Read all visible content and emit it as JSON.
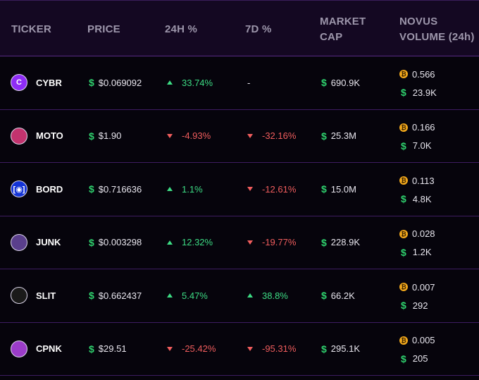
{
  "headers": {
    "ticker": "TICKER",
    "price": "PRICE",
    "change_24h": "24H %",
    "change_7d": "7D %",
    "market_cap_1": "MARKET",
    "market_cap_2": "CAP",
    "volume_1": "NOVUS",
    "volume_2": "VOLUME (24h)"
  },
  "currency_symbol": "$",
  "btc_symbol": "₿",
  "rows": [
    {
      "ticker": "CYBR",
      "icon": "C",
      "icon_bg": "#8e2cf5",
      "price": "$0.069092",
      "change_24h": "33.74%",
      "change_24h_dir": "up",
      "change_7d": "-",
      "change_7d_dir": "none",
      "market_cap": "690.9K",
      "vol_btc": "0.566",
      "vol_usd": "23.9K"
    },
    {
      "ticker": "MOTO",
      "icon": "",
      "icon_bg": "#c2336e",
      "price": "$1.90",
      "change_24h": "-4.93%",
      "change_24h_dir": "down",
      "change_7d": "-32.16%",
      "change_7d_dir": "down",
      "market_cap": "25.3M",
      "vol_btc": "0.166",
      "vol_usd": "7.0K"
    },
    {
      "ticker": "BORD",
      "icon": "[◉]",
      "icon_bg": "#1434d6",
      "price": "$0.716636",
      "change_24h": "1.1%",
      "change_24h_dir": "up",
      "change_7d": "-12.61%",
      "change_7d_dir": "down",
      "market_cap": "15.0M",
      "vol_btc": "0.113",
      "vol_usd": "4.8K"
    },
    {
      "ticker": "JUNK",
      "icon": "",
      "icon_bg": "#5a3f8c",
      "price": "$0.003298",
      "change_24h": "12.32%",
      "change_24h_dir": "up",
      "change_7d": "-19.77%",
      "change_7d_dir": "down",
      "market_cap": "228.9K",
      "vol_btc": "0.028",
      "vol_usd": "1.2K"
    },
    {
      "ticker": "SLIT",
      "icon": "",
      "icon_bg": "#1a1a1a",
      "price": "$0.662437",
      "change_24h": "5.47%",
      "change_24h_dir": "up",
      "change_7d": "38.8%",
      "change_7d_dir": "up",
      "market_cap": "66.2K",
      "vol_btc": "0.007",
      "vol_usd": "292"
    },
    {
      "ticker": "CPNK",
      "icon": "",
      "icon_bg": "#9b3cc9",
      "price": "$29.51",
      "change_24h": "-25.42%",
      "change_24h_dir": "down",
      "change_7d": "-95.31%",
      "change_7d_dir": "down",
      "market_cap": "295.1K",
      "vol_btc": "0.005",
      "vol_usd": "205"
    }
  ]
}
